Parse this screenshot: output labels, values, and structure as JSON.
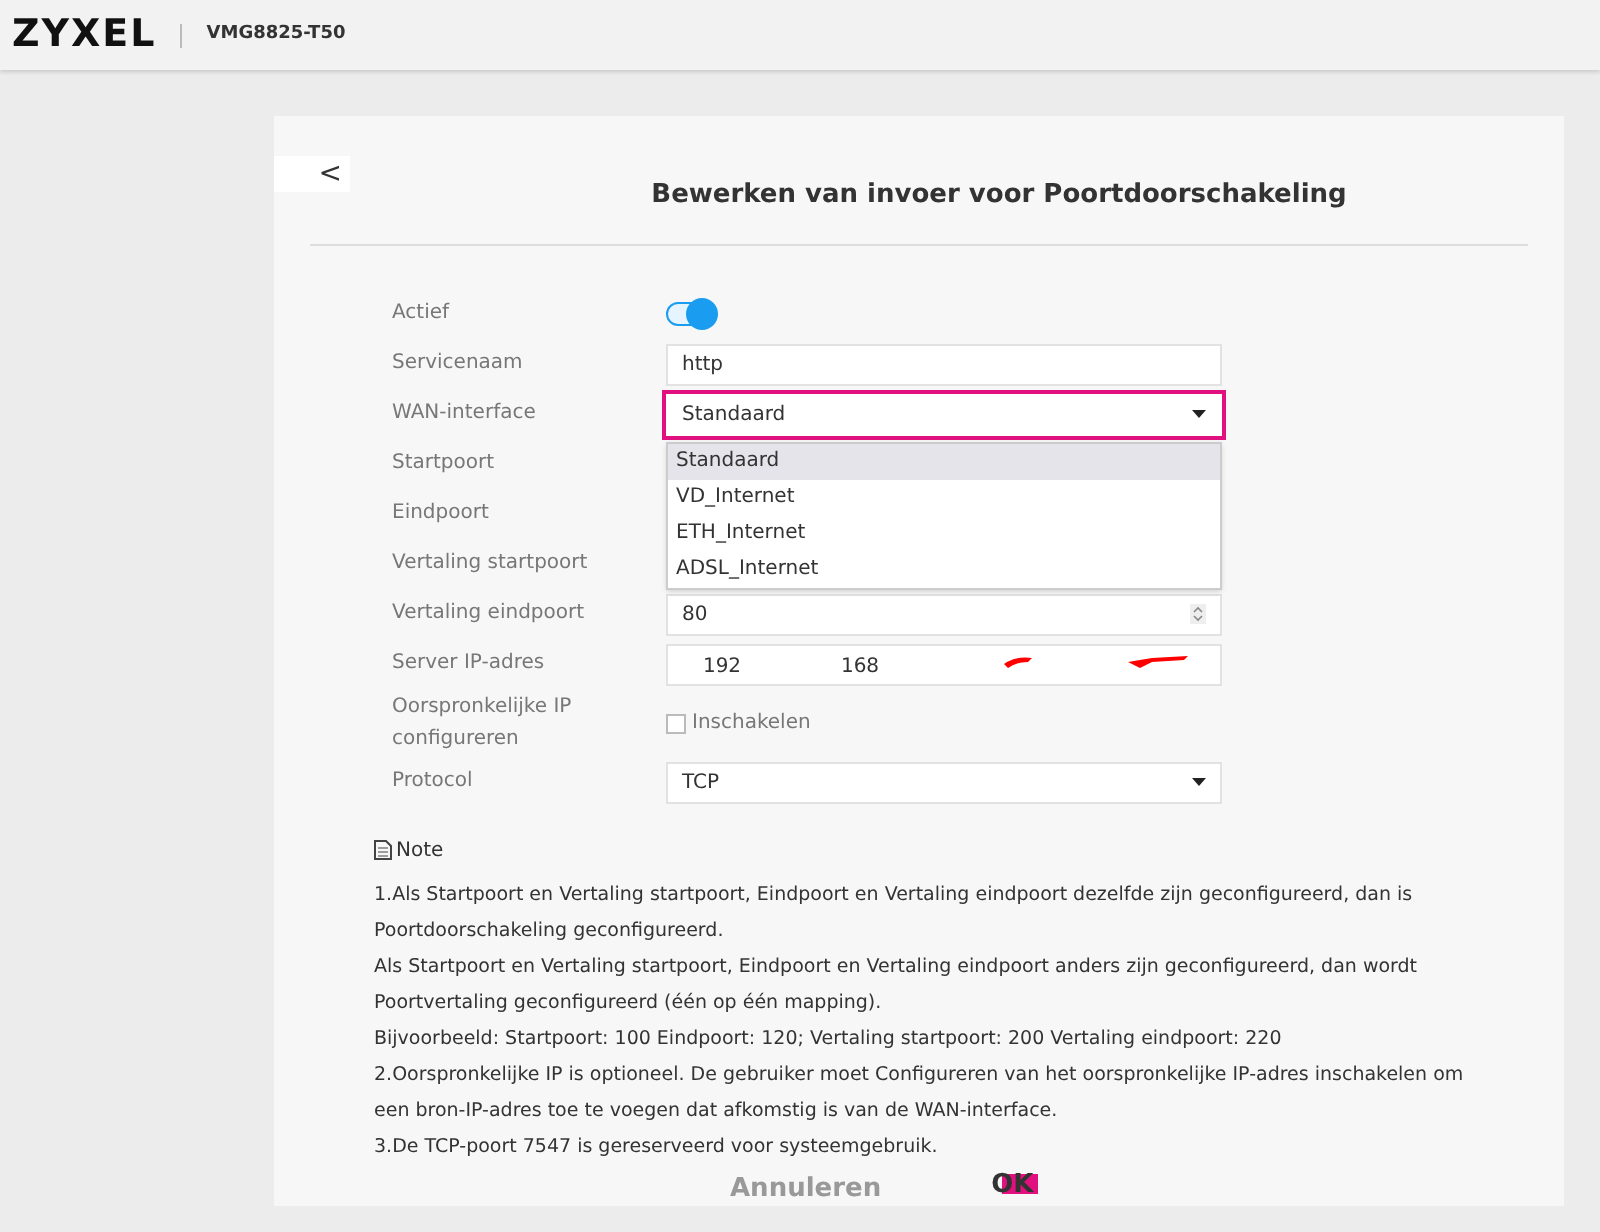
{
  "header": {
    "brand": "ZYXEL",
    "model": "VMG8825-T50"
  },
  "dialog": {
    "back": "<",
    "title": "Bewerken van invoer voor Poortdoorschakeling"
  },
  "form": [
    {
      "kind": "toggle",
      "label": "Actief",
      "on": true
    },
    {
      "kind": "text",
      "label": "Servicenaam",
      "value": "http"
    },
    {
      "kind": "select",
      "label": "WAN-interface",
      "value": "Standaard",
      "focused": true,
      "expanded": true,
      "options": [
        {
          "label": "Standaard",
          "selected": true
        },
        {
          "label": "VD_Internet",
          "selected": false
        },
        {
          "label": "ETH_Internet",
          "selected": false
        },
        {
          "label": "ADSL_Internet",
          "selected": false
        }
      ]
    },
    {
      "kind": "hidden",
      "label": "Startpoort"
    },
    {
      "kind": "hidden",
      "label": "Eindpoort"
    },
    {
      "kind": "hidden",
      "label": "Vertaling startpoort"
    },
    {
      "kind": "number",
      "label": "Vertaling eindpoort",
      "value": "80"
    },
    {
      "kind": "ip",
      "label": "Server IP-adres",
      "octets": [
        "192",
        "168"
      ]
    },
    {
      "kind": "checkbox",
      "label": "Oorspronkelijke IP configureren",
      "option": "Inschakelen",
      "checked": false
    },
    {
      "kind": "select",
      "label": "Protocol",
      "value": "TCP",
      "focused": false,
      "expanded": false
    }
  ],
  "note": {
    "title": "Note",
    "lines": [
      "1.Als Startpoort en Vertaling startpoort, Eindpoort en Vertaling eindpoort dezelfde zijn geconfigureerd, dan is Poortdoorschakeling geconfigureerd.",
      "Als Startpoort en Vertaling startpoort, Eindpoort en Vertaling eindpoort anders zijn geconfigureerd, dan wordt Poortvertaling geconfigureerd (één op één mapping).",
      "Bijvoorbeeld: Startpoort: 100 Eindpoort: 120; Vertaling startpoort: 200 Vertaling eindpoort: 220",
      "2.Oorspronkelijke IP is optioneel. De gebruiker moet Configureren van het oorspronkelijke IP-adres inschakelen om een bron-IP-adres toe te voegen dat afkomstig is van de WAN-interface.",
      "3.De TCP-poort 7547 is gereserveerd voor systeemgebruik."
    ]
  },
  "buttons": {
    "cancel": "Annuleren",
    "ok": "OK"
  }
}
